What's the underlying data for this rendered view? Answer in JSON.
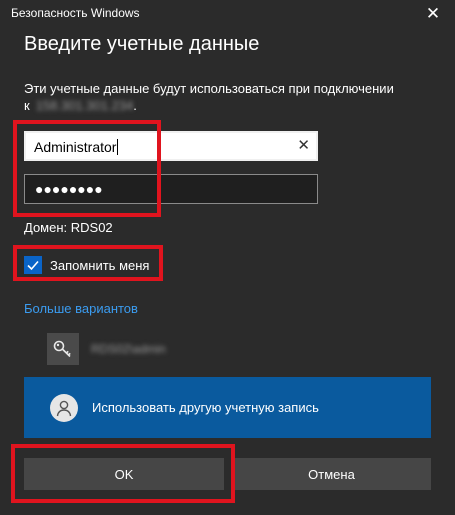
{
  "window": {
    "app_title": "Безопасность Windows",
    "close_glyph": "✕"
  },
  "dialog": {
    "heading": "Введите учетные данные",
    "description": "Эти учетные данные будут использоваться при подключении к",
    "host_masked": "158.301.301.234",
    "description_end": "."
  },
  "form": {
    "username": {
      "value": "Administrator",
      "clear_glyph": "✕"
    },
    "password": {
      "masked_value": "●●●●●●●●"
    },
    "domain_text": "Домен: RDS02",
    "remember": {
      "label": "Запомнить меня",
      "checked": true
    }
  },
  "more_options": {
    "link_label": "Больше вариантов",
    "saved_account": {
      "icon": "key-icon",
      "name_masked": "RDS02\\admin"
    },
    "other_account": {
      "icon": "user-icon",
      "label": "Использовать другую учетную запись"
    }
  },
  "buttons": {
    "ok_label": "OK",
    "cancel_label": "Отмена"
  },
  "colors": {
    "background": "#2b2b2b",
    "accent": "#0a5a9e",
    "checkbox": "#0a64c8",
    "link": "#3b9cf0",
    "highlight": "#e0141e",
    "button": "#464646"
  }
}
